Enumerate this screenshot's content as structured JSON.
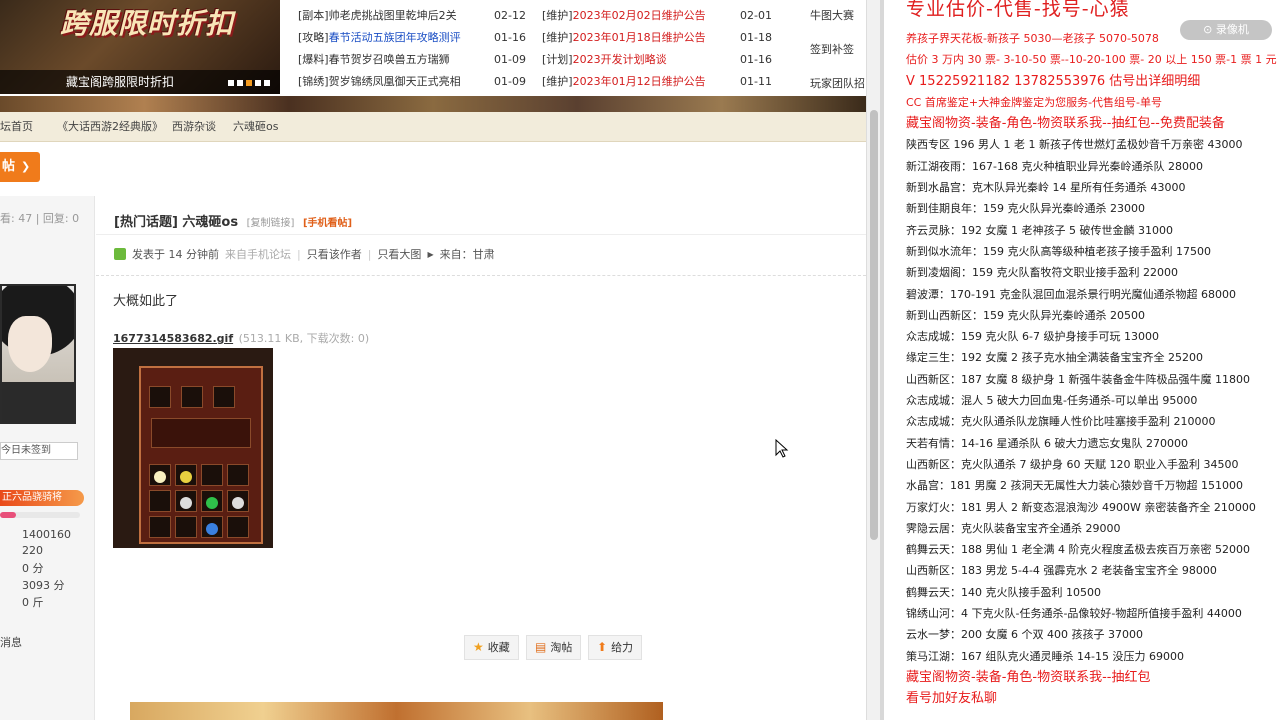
{
  "banner": {
    "headline": "跨服限时折扣",
    "caption": "藏宝阁跨服限时折扣",
    "dots": 5,
    "active_dot": 2
  },
  "news_left": [
    {
      "tag": "[副本]",
      "text": "帅老虎挑战图里乾坤后2关",
      "color": "dark",
      "date": "02-12"
    },
    {
      "tag": "[攻略]",
      "text": "春节活动五族团年攻略测评",
      "color": "blue",
      "date": "01-16"
    },
    {
      "tag": "[爆料]",
      "text": "春节贺岁召唤兽五方瑞狮",
      "color": "dark",
      "date": "01-09"
    },
    {
      "tag": "[锦绣]",
      "text": "贺岁锦绣凤凰御天正式亮相",
      "color": "dark",
      "date": "01-09"
    }
  ],
  "news_mid": [
    {
      "tag": "[维护]",
      "text": "2023年02月02日维护公告",
      "date": "02-01"
    },
    {
      "tag": "[维护]",
      "text": "2023年01月18日维护公告",
      "date": "01-18"
    },
    {
      "tag": "[计划]",
      "text": "2023开发计划略谈",
      "date": "01-16"
    },
    {
      "tag": "[维护]",
      "text": "2023年01月12日维护公告",
      "date": "01-11"
    }
  ],
  "news_right": [
    "牛图大赛",
    "签到补签",
    "玩家团队招"
  ],
  "breadcrumb": {
    "forum_home": "坛首页",
    "section": "《大话西游2经典版》",
    "subsection": "西游杂谈",
    "topic": "六魂砸os"
  },
  "post_button": "帖",
  "user": {
    "view_reply": "看: 47 | 回复: 0",
    "signin": "今日未签到",
    "rank_badge": "正六品骁骑将",
    "rank_progress": 0.2,
    "stats": [
      "1400160",
      "220",
      "0 分",
      "3093 分",
      "0 斤"
    ],
    "message_link": "消息"
  },
  "post": {
    "title": "[热门话题] 六魂砸os",
    "copy_link": "[复制链接]",
    "mobile_view": "[手机看帖]",
    "posted": "发表于 14 分钟前",
    "from_mobile": "来自手机论坛",
    "only_author": "只看该作者",
    "only_large_img": "只看大图",
    "from_location": "来自：甘肃",
    "body": "大概如此了",
    "attachment_name": "1677314583682.gif",
    "attachment_info": "(513.11 KB, 下载次数: 0)"
  },
  "actions": [
    {
      "label": "收藏",
      "icon": "star-icon"
    },
    {
      "label": "淘帖",
      "icon": "collection-icon"
    },
    {
      "label": "给力",
      "icon": "up-arrow-icon"
    }
  ],
  "overlay": {
    "title": "专业估价-代售-找号-心猿",
    "watermark": "⊙ 录像机",
    "lines": [
      {
        "text": "养孩子界天花板-新孩子 5030—老孩子 5070-5078",
        "style": "red"
      },
      {
        "text": "估价 3 万内 30 票- 3-10-50 票--10-20-100 票- 20 以上 150 票-1 票 1 元",
        "style": "red"
      },
      {
        "text": "V 15225921182    13782553976    估号出详细明细",
        "style": "red big"
      },
      {
        "text": "CC 首席鉴定+大神金牌鉴定为您服务-代售组号-单号",
        "style": "red"
      },
      {
        "text": "藏宝阁物资-装备-角色-物资联系我--抽红包--免费配装备",
        "style": "red big"
      },
      {
        "text": "陕西专区 196 男人 1 老 1 新孩子传世燃灯孟极妙音千万亲密 43000",
        "style": ""
      },
      {
        "text": "新江湖夜雨：167-168 克火种植职业异光秦岭通杀队 28000",
        "style": ""
      },
      {
        "text": "新到水晶宫：克木队异光秦岭 14 星所有任务通杀 43000",
        "style": ""
      },
      {
        "text": "新到佳期良年：159 克火队异光秦岭通杀 23000",
        "style": ""
      },
      {
        "text": "齐云灵脉：192 女魔 1 老神孩子 5 破传世金麟 31000",
        "style": ""
      },
      {
        "text": "新到似水流年：159 克火队高等级种植老孩子接手盈利 17500",
        "style": ""
      },
      {
        "text": "新到凌烟阁：159 克火队畜牧符文职业接手盈利 22000",
        "style": ""
      },
      {
        "text": "碧波潭：170-191 克金队混回血混杀景行明光魔仙通杀物超 68000",
        "style": ""
      },
      {
        "text": "新到山西新区：159 克火队异光秦岭通杀 20500",
        "style": ""
      },
      {
        "text": "众志成城：159 克火队 6-7 级护身接手可玩 13000",
        "style": ""
      },
      {
        "text": "缘定三生：192 女魔 2 孩子克水抽全满装备宝宝齐全 25200",
        "style": ""
      },
      {
        "text": "山西新区：187 女魔 8 级护身 1 新强牛装备金牛阵极品强牛魔 11800",
        "style": ""
      },
      {
        "text": "众志成城：混人 5 破大力回血鬼-任务通杀-可以单出 95000",
        "style": ""
      },
      {
        "text": "众志成城：克火队通杀队龙旗睡人性价比哇塞接手盈利 210000",
        "style": ""
      },
      {
        "text": "天若有情：14-16 星通杀队 6 破大力遗忘女鬼队 270000",
        "style": ""
      },
      {
        "text": "山西新区：克火队通杀 7 级护身 60 天赋 120 职业入手盈利 34500",
        "style": ""
      },
      {
        "text": "水晶宫：181 男魔 2 孩洞天无属性大力装心猿妙音千万物超 151000",
        "style": ""
      },
      {
        "text": "万家灯火：181 男人 2 新变态混浪淘沙 4900W 亲密装备齐全 210000",
        "style": ""
      },
      {
        "text": "霁隐云居：克火队装备宝宝齐全通杀 29000",
        "style": ""
      },
      {
        "text": "鹤舞云天：188 男仙 1 老全满 4 阶克火程度孟极去疾百万亲密 52000",
        "style": ""
      },
      {
        "text": "山西新区：183 男龙 5-4-4 强霹克水 2 老装备宝宝齐全 98000",
        "style": ""
      },
      {
        "text": "鹤舞云天：140 克火队接手盈利 10500",
        "style": ""
      },
      {
        "text": "锦绣山河：4 下克火队-任务通杀-品像较好-物超所值接手盈利 44000",
        "style": ""
      },
      {
        "text": "云水一梦：200 女魔 6 个双 400 孩孩子 37000",
        "style": ""
      },
      {
        "text": "策马江湖：167 组队克火通灵睡杀 14-15 没压力 69000",
        "style": ""
      },
      {
        "text": "藏宝阁物资-装备-角色-物资联系我--抽红包",
        "style": "red big"
      },
      {
        "text": "看号加好友私聊",
        "style": "red big"
      }
    ]
  },
  "colors": {
    "accent_orange": "#f07b1b",
    "news_red": "#d31c1c",
    "news_blue": "#1a4ec4",
    "overlay_red": "#e81c1c",
    "crumb_bg": "#f2ecdb"
  }
}
